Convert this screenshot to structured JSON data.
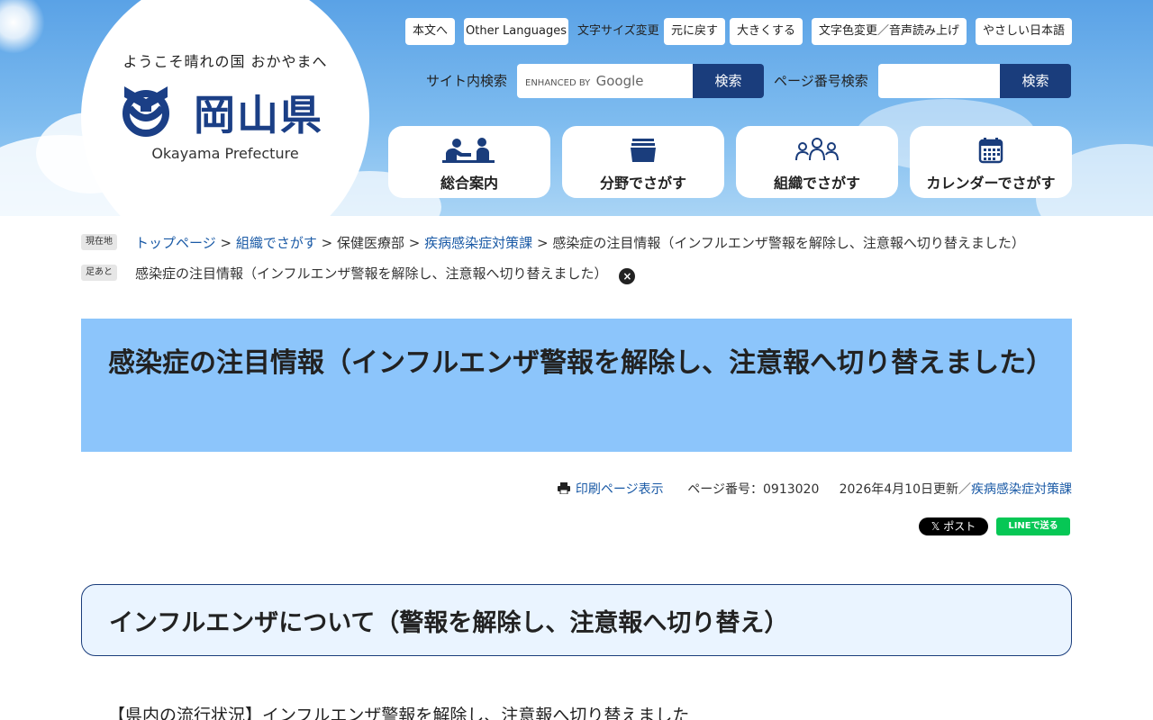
{
  "logo": {
    "tagline": "ようこそ晴れの国 おかやまへ",
    "name": "岡山県",
    "english": "Okayama Prefecture"
  },
  "top_links": {
    "main_text": "本文へ",
    "other_languages": "Other Languages",
    "font_size_label": "文字サイズ変更",
    "reset": "元に戻す",
    "enlarge": "大きくする",
    "color_voice": "文字色変更／音声読み上げ",
    "easy_japanese": "やさしい日本語"
  },
  "search": {
    "site_label": "サイト内検索",
    "enhanced_by": "ENHANCED BY",
    "google": "Google",
    "site_button": "検索",
    "page_number_label": "ページ番号検索",
    "page_button": "検索"
  },
  "nav": [
    {
      "label": "総合案内",
      "icon": "people-icon"
    },
    {
      "label": "分野でさがす",
      "icon": "folder-stack-icon"
    },
    {
      "label": "組織でさがす",
      "icon": "organization-icon"
    },
    {
      "label": "カレンダーでさがす",
      "icon": "calendar-icon"
    }
  ],
  "breadcrumb": {
    "current_tag": "現在地",
    "items": [
      "トップページ",
      "組織でさがす",
      "保健医療部",
      "疾病感染症対策課",
      "感染症の注目情報（インフルエンザ警報を解除し、注意報へ切り替えました）"
    ],
    "separator": ">",
    "footprint_tag": "足あと",
    "footprint_item": "感染症の注目情報（インフルエンザ警報を解除し、注意報へ切り替えました）",
    "close_symbol": "×"
  },
  "page_title": "感染症の注目情報（インフルエンザ警報を解除し、注意報へ切り替えました）",
  "meta": {
    "print_label": "印刷ページ表示",
    "page_number": "ページ番号：0913020",
    "updated": "2026年4月10日更新／",
    "department": "疾病感染症対策課"
  },
  "share": {
    "x_post": "𝕏 ポスト",
    "line": "LINEで送る"
  },
  "section_heading": "インフルエンザについて（警報を解除し、注意報へ切り替え）",
  "body_text": "【県内の流行状況】インフルエンザ警報を解除し、注意報へ切り替えました",
  "colors": {
    "header_sky": "#7dbbef",
    "title_bg": "#8cc5fb",
    "search_button": "#1a3d7c",
    "link": "#1a5aa6",
    "line_green": "#06c755"
  }
}
